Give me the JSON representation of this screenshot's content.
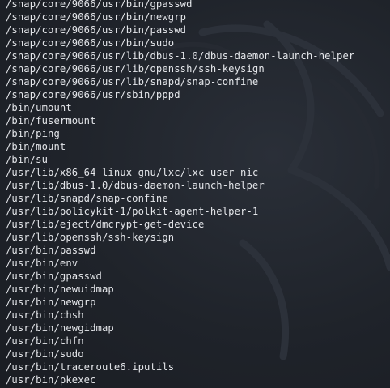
{
  "terminal": {
    "lines": [
      "/snap/core/9066/usr/bin/gpasswd",
      "/snap/core/9066/usr/bin/newgrp",
      "/snap/core/9066/usr/bin/passwd",
      "/snap/core/9066/usr/bin/sudo",
      "/snap/core/9066/usr/lib/dbus-1.0/dbus-daemon-launch-helper",
      "/snap/core/9066/usr/lib/openssh/ssh-keysign",
      "/snap/core/9066/usr/lib/snapd/snap-confine",
      "/snap/core/9066/usr/sbin/pppd",
      "/bin/umount",
      "/bin/fusermount",
      "/bin/ping",
      "/bin/mount",
      "/bin/su",
      "/usr/lib/x86_64-linux-gnu/lxc/lxc-user-nic",
      "/usr/lib/dbus-1.0/dbus-daemon-launch-helper",
      "/usr/lib/snapd/snap-confine",
      "/usr/lib/policykit-1/polkit-agent-helper-1",
      "/usr/lib/eject/dmcrypt-get-device",
      "/usr/lib/openssh/ssh-keysign",
      "/usr/bin/passwd",
      "/usr/bin/env",
      "/usr/bin/gpasswd",
      "/usr/bin/newuidmap",
      "/usr/bin/newgrp",
      "/usr/bin/chsh",
      "/usr/bin/newgidmap",
      "/usr/bin/chfn",
      "/usr/bin/sudo",
      "/usr/bin/traceroute6.iputils",
      "/usr/bin/pkexec"
    ],
    "colors": {
      "background": "#1d2128",
      "text": "#e4e6ea"
    },
    "watermark_icon": "kali-dragon-icon"
  }
}
